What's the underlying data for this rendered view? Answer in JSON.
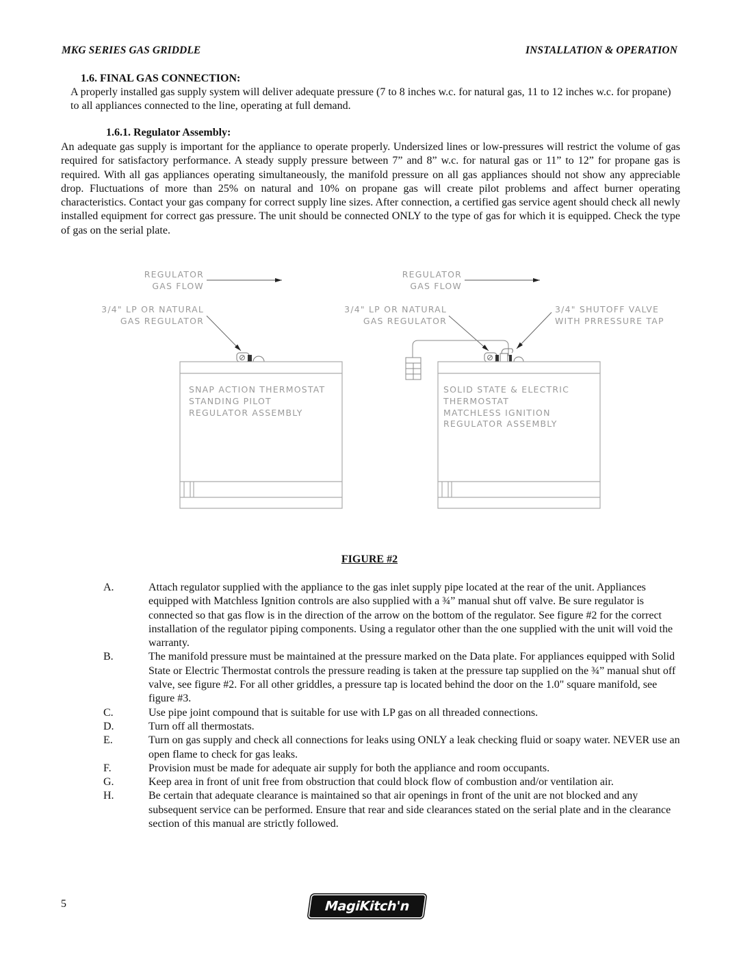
{
  "header": {
    "left": "MKG SERIES GAS GRIDDLE",
    "right": "INSTALLATION & OPERATION"
  },
  "section": {
    "title": "1.6.  FINAL GAS CONNECTION:",
    "body": "A properly installed gas supply system will deliver adequate pressure (7 to 8 inches w.c. for natural gas, 11 to 12 inches w.c. for propane) to all appliances connected to the line, operating at full demand."
  },
  "subsection": {
    "title": "1.6.1. Regulator Assembly:",
    "body": "An adequate gas supply is important for the appliance to operate properly. Undersized lines or low-pressures will restrict the volume of gas required for satisfactory performance. A steady supply pressure between 7” and 8” w.c. for natural gas or 11” to 12” for propane gas is required. With all gas appliances operating simultaneously, the manifold pressure on all gas appliances should not show any appreciable drop. Fluctuations of more than 25% on natural and 10% on propane gas will create pilot problems and affect burner operating characteristics. Contact your gas company for correct supply line sizes. After connection, a certified gas service agent should check all newly installed equipment for correct gas pressure. The unit should be connected ONLY to the type of gas for which it is equipped. Check the type of gas on the serial plate."
  },
  "figure": {
    "caption": "FIGURE #2",
    "left_unit": {
      "flow_label": [
        "REGULATOR",
        "GAS FLOW"
      ],
      "regulator_label": [
        "3/4\" LP OR NATURAL",
        "GAS REGULATOR"
      ],
      "body_label": [
        "SNAP ACTION THERMOSTAT",
        "STANDING PILOT",
        "REGULATOR ASSEMBLY"
      ]
    },
    "right_unit": {
      "flow_label": [
        "REGULATOR",
        "GAS FLOW"
      ],
      "regulator_label": [
        "3/4\" LP OR NATURAL",
        "GAS REGULATOR"
      ],
      "valve_label": [
        "3/4\" SHUTOFF VALVE",
        "WITH PRRESSURE TAP"
      ],
      "body_label": [
        "SOLID STATE & ELECTRIC",
        "THERMOSTAT",
        "MATCHLESS IGNITION",
        "REGULATOR ASSEMBLY"
      ]
    }
  },
  "steps": [
    {
      "label": "A.",
      "text": "Attach regulator supplied with the appliance to the gas inlet supply pipe located at the rear of the unit. Appliances equipped with Matchless Ignition controls are also supplied with a ¾” manual shut off valve. Be sure regulator is connected so that gas flow is in the direction of the arrow on the bottom of the regulator. See figure #2 for the correct installation of the regulator piping components. Using a regulator other than the one supplied with the unit will void the warranty."
    },
    {
      "label": "B.",
      "text": "The manifold pressure must be maintained at the pressure marked on the Data plate. For appliances equipped with Solid State or Electric Thermostat controls the pressure reading is taken at the pressure tap supplied on the ¾” manual shut off valve, see figure #2. For all other griddles, a pressure tap is located behind the door on the 1.0\" square manifold, see figure #3."
    },
    {
      "label": "C.",
      "text": "Use pipe joint compound that is suitable for use with LP gas on all threaded connections."
    },
    {
      "label": "D.",
      "text": "Turn off all thermostats."
    },
    {
      "label": "E.",
      "text": "Turn on gas supply and check all connections for leaks using ONLY a leak checking fluid or soapy water. NEVER use an open flame to check for gas leaks."
    },
    {
      "label": "F.",
      "text": "Provision must be made for adequate air supply for both the appliance and room occupants."
    },
    {
      "label": "G.",
      "text": "Keep area in front of unit free from obstruction that could block flow of combustion and/or ventilation air."
    },
    {
      "label": "H.",
      "text": "Be certain that adequate clearance is maintained so that air openings in front of the unit are not blocked and any subsequent service can be performed. Ensure that rear and side clearances stated on the serial plate and in the clearance section of this manual are strictly followed."
    }
  ],
  "footer": {
    "page_number": "5",
    "logo_text": "MagiKitch'n"
  }
}
